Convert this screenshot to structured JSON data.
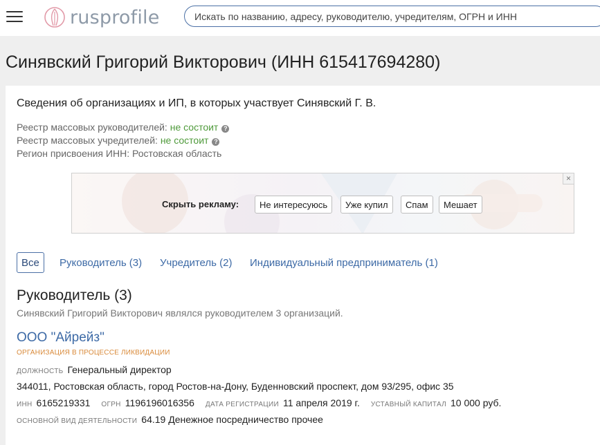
{
  "header": {
    "logo_text": "rusprofile",
    "search_placeholder": "Искать по названию, адресу, руководителю, учредителям, ОГРН и ИНН"
  },
  "page": {
    "title": "Синявский Григорий Викторович (ИНН 615417694280)"
  },
  "card": {
    "subtitle": "Сведения об организациях и ИП, в которых участвует Синявский Г. В.",
    "registry": [
      {
        "label": "Реестр массовых руководителей:",
        "value": "не состоит"
      },
      {
        "label": "Реестр массовых учредителей:",
        "value": "не состоит"
      }
    ],
    "region_label": "Регион присвоения ИНН:",
    "region_value": "Ростовская область"
  },
  "ad": {
    "close": "×",
    "hide_label": "Скрыть рекламу:",
    "buttons": [
      "Не интересуюсь",
      "Уже купил",
      "Спам",
      "Мешает"
    ]
  },
  "tabs": [
    {
      "label": "Все",
      "active": true
    },
    {
      "label": "Руководитель (3)"
    },
    {
      "label": "Учредитель (2)"
    },
    {
      "label": "Индивидуальный предприниматель (1)"
    }
  ],
  "section": {
    "title": "Руководитель (3)",
    "description": "Синявский Григорий Викторович являлся руководителем 3 организаций."
  },
  "organization": {
    "name": "ООО \"Айрейз\"",
    "status": "Организация в процессе ликвидации",
    "position_label": "должность",
    "position": "Генеральный директор",
    "address": "344011, Ростовская область, город Ростов-на-Дону, Буденновский проспект, дом 93/295, офис 35",
    "inn_label": "ИНН",
    "inn": "6165219331",
    "ogrn_label": "ОГРН",
    "ogrn": "1196196016356",
    "reg_date_label": "дата регистрации",
    "reg_date": "11 апреля 2019 г.",
    "capital_label": "уставный капитал",
    "capital": "10 000 руб.",
    "activity_label": "основной вид деятельности",
    "activity": "64.19 Денежное посредничество прочее"
  },
  "colors": {
    "accent": "#3d6aa6",
    "green": "#4f9a3b",
    "status_orange": "#d98a3a"
  }
}
